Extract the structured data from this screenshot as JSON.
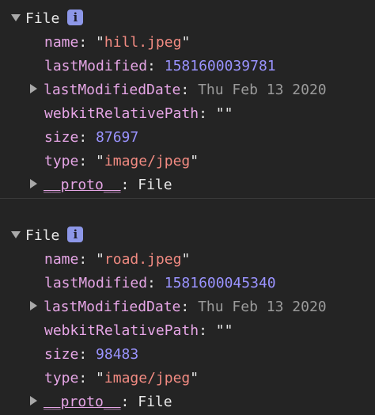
{
  "entries": [
    {
      "type_label": "File",
      "info_icon": "i",
      "name_key": "name",
      "name_value": "hill.jpeg",
      "lastModified_key": "lastModified",
      "lastModified_value": "1581600039781",
      "lastModifiedDate_key": "lastModifiedDate",
      "lastModifiedDate_value": "Thu Feb 13 2020",
      "webkitRelativePath_key": "webkitRelativePath",
      "webkitRelativePath_value": "\"\"",
      "size_key": "size",
      "size_value": "87697",
      "type_key": "type",
      "type_value": "image/jpeg",
      "proto_key": "__proto__",
      "proto_value": "File"
    },
    {
      "type_label": "File",
      "info_icon": "i",
      "name_key": "name",
      "name_value": "road.jpeg",
      "lastModified_key": "lastModified",
      "lastModified_value": "1581600045340",
      "lastModifiedDate_key": "lastModifiedDate",
      "lastModifiedDate_value": "Thu Feb 13 2020",
      "webkitRelativePath_key": "webkitRelativePath",
      "webkitRelativePath_value": "\"\"",
      "size_key": "size",
      "size_value": "98483",
      "type_key": "type",
      "type_value": "image/jpeg",
      "proto_key": "__proto__",
      "proto_value": "File"
    }
  ],
  "colors": {
    "background": "#242424",
    "key": "#e5a5e5",
    "string": "#f28b82",
    "number": "#9a93ff",
    "date": "#9b9b9b",
    "info_badge": "#8d97e8"
  },
  "icons": {
    "expanded": "triangle-down-icon",
    "collapsed": "triangle-right-icon",
    "info": "info-icon"
  }
}
